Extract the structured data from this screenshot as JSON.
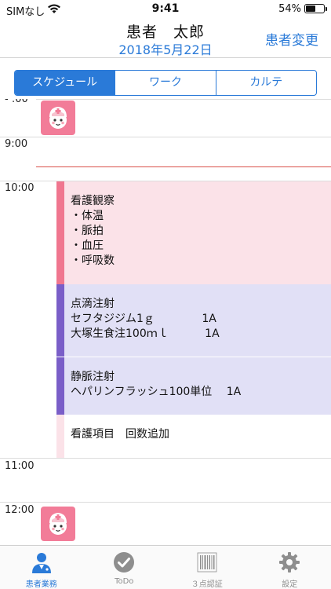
{
  "status_bar": {
    "carrier": "SIMなし",
    "time": "9:41",
    "battery": "54%",
    "battery_level": 0.54
  },
  "header": {
    "patient_name": "患者　太郎",
    "date": "2018年5月22日",
    "change_patient": "患者変更"
  },
  "segments": [
    {
      "label": "スケジュール",
      "selected": true
    },
    {
      "label": "ワーク",
      "selected": false
    },
    {
      "label": "カルテ",
      "selected": false
    }
  ],
  "schedule": {
    "hours": [
      "9:00",
      "10:00",
      "11:00",
      "12:00"
    ],
    "events": [
      {
        "color": "pink",
        "lines": [
          "看護観察",
          "・体温",
          "・脈拍",
          "・血圧",
          "・呼吸数"
        ]
      },
      {
        "color": "purple",
        "lines": [
          "点滴注射",
          "セフタジジム1ｇ　　　　 1A",
          "大塚生食注100ｍｌ　　　 1A"
        ]
      },
      {
        "color": "purple",
        "lines": [
          "静脈注射",
          "ヘパリンフラッシュ100単位　 1A"
        ]
      },
      {
        "color": "plain",
        "lines": [
          "看護項目　回数追加"
        ]
      }
    ]
  },
  "tabs": [
    {
      "label": "患者業務",
      "icon": "nurse-person-icon",
      "active": true
    },
    {
      "label": "ToDo",
      "icon": "checkmark-circle-icon",
      "active": false
    },
    {
      "label": "３点認証",
      "icon": "barcode-icon",
      "active": false
    },
    {
      "label": "設定",
      "icon": "gear-icon",
      "active": false
    }
  ],
  "colors": {
    "accent": "#2a7ad8",
    "pink_event": "#fbe2e8",
    "pink_bar": "#f0768f",
    "purple_event": "#e1e0f6",
    "purple_bar": "#7a5ec8",
    "now_line": "#d9504a",
    "nurse_badge": "#f27c98"
  }
}
